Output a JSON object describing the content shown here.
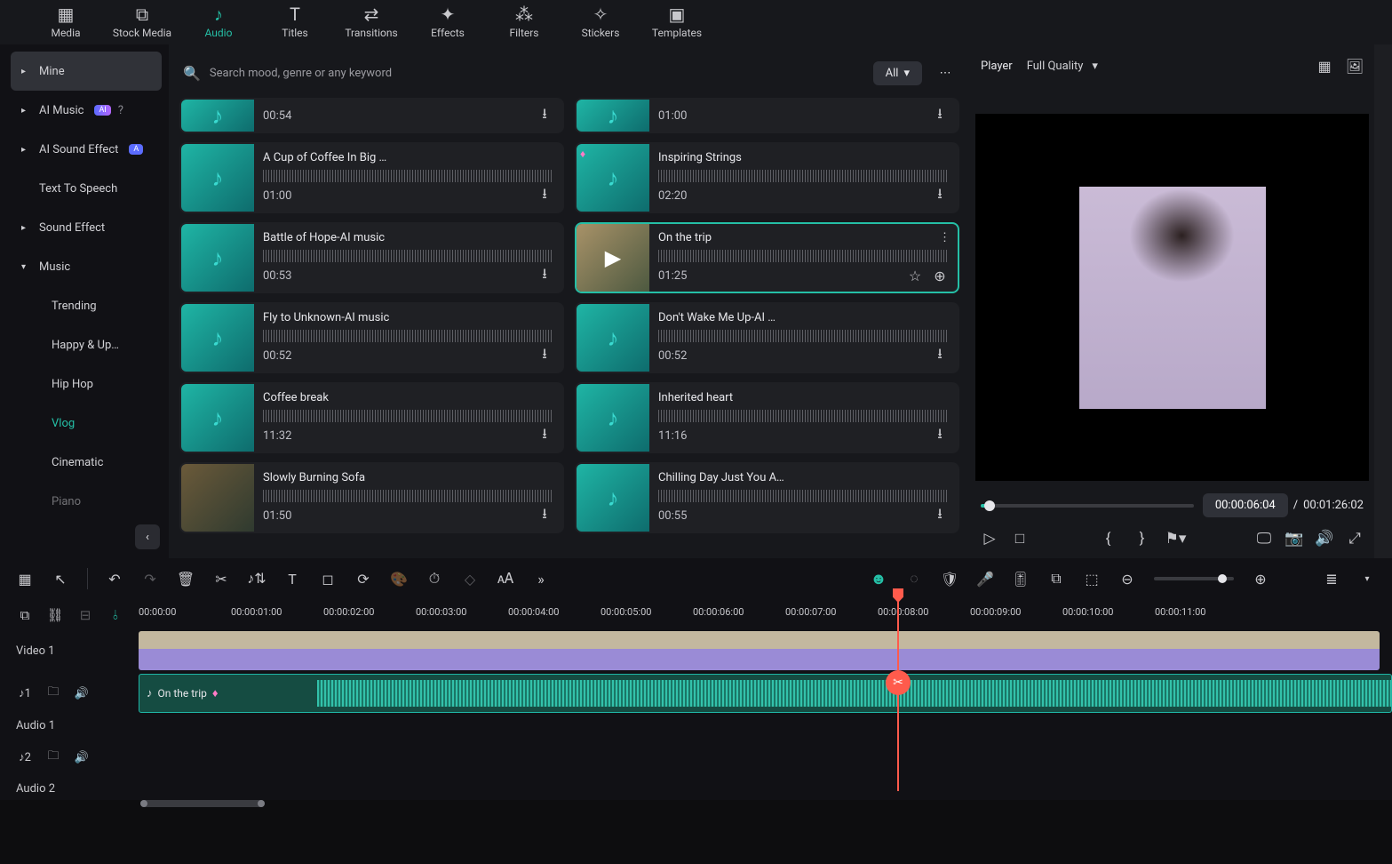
{
  "top_tabs": [
    {
      "label": "Media"
    },
    {
      "label": "Stock Media"
    },
    {
      "label": "Audio"
    },
    {
      "label": "Titles"
    },
    {
      "label": "Transitions"
    },
    {
      "label": "Effects"
    },
    {
      "label": "Filters"
    },
    {
      "label": "Stickers"
    },
    {
      "label": "Templates"
    }
  ],
  "active_top_tab": "Audio",
  "sidebar": [
    {
      "label": "Mine",
      "caret": true,
      "selected": true
    },
    {
      "label": "AI Music",
      "caret": true,
      "badge": "AI",
      "help": true
    },
    {
      "label": "AI Sound Effect",
      "caret": true,
      "badge": "A"
    },
    {
      "label": "Text To Speech"
    },
    {
      "label": "Sound Effect",
      "caret": true
    },
    {
      "label": "Music",
      "caret": true,
      "expanded": true,
      "children": [
        {
          "label": "Trending"
        },
        {
          "label": "Happy & Up…"
        },
        {
          "label": "Hip Hop"
        },
        {
          "label": "Vlog",
          "active": true
        },
        {
          "label": "Cinematic"
        },
        {
          "label": "Piano"
        }
      ]
    }
  ],
  "search": {
    "placeholder": "Search mood, genre or any keyword"
  },
  "filter": {
    "label": "All"
  },
  "tracks": [
    {
      "title": "",
      "time": "00:54"
    },
    {
      "title": "",
      "time": "01:00"
    },
    {
      "title": "A Cup of Coffee In Big …",
      "time": "01:00"
    },
    {
      "title": "Inspiring Strings",
      "time": "02:20",
      "gem": true
    },
    {
      "title": "Battle of Hope-AI music",
      "time": "00:53"
    },
    {
      "title": "On the trip",
      "time": "01:25",
      "selected": true,
      "thumb": "image",
      "play": true,
      "fav": true,
      "add": true,
      "more": true
    },
    {
      "title": "Fly to Unknown-AI music",
      "time": "00:52"
    },
    {
      "title": "Don't Wake Me Up-AI …",
      "time": "00:52"
    },
    {
      "title": "Coffee break",
      "time": "11:32"
    },
    {
      "title": "Inherited heart",
      "time": "11:16"
    },
    {
      "title": "Slowly Burning Sofa",
      "time": "01:50",
      "thumb": "image"
    },
    {
      "title": "Chilling Day Just You A…",
      "time": "00:55"
    }
  ],
  "player": {
    "label": "Player",
    "quality": "Full Quality",
    "current_time": "00:00:06:04",
    "sep": "/",
    "total_time": "00:01:26:02"
  },
  "ruler": [
    "00:00:00",
    "00:00:01:00",
    "00:00:02:00",
    "00:00:03:00",
    "00:00:04:00",
    "00:00:05:00",
    "00:00:06:00",
    "00:00:07:00",
    "00:00:08:00",
    "00:00:09:00",
    "00:00:10:00",
    "00:00:11:00"
  ],
  "timeline": {
    "video_track": "Video 1",
    "audio1_track": "Audio 1",
    "audio2_track": "Audio 2",
    "audio_clip": "On the trip"
  }
}
